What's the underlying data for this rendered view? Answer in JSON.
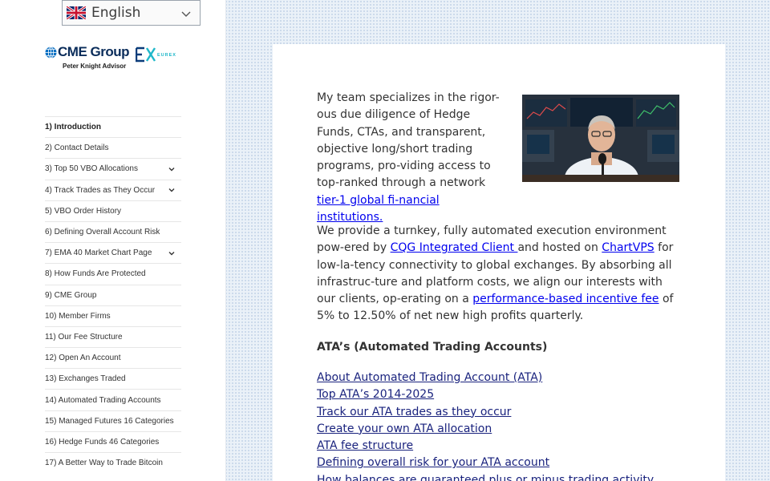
{
  "language": {
    "selected": "English"
  },
  "logo": {
    "brand": "CME Group",
    "subtitle": "Peter Knight Advisor",
    "partner": "EUREX"
  },
  "nav": {
    "items": [
      {
        "label": "1) Introduction",
        "has_toggle": false
      },
      {
        "label": "2) Contact Details",
        "has_toggle": false
      },
      {
        "label": "3) Top 50 VBO Allocations",
        "has_toggle": true
      },
      {
        "label": "4) Track Trades as They Occur",
        "has_toggle": true
      },
      {
        "label": "5) VBO Order History",
        "has_toggle": false
      },
      {
        "label": "6) Defining Overall Account Risk",
        "has_toggle": false
      },
      {
        "label": "7) EMA 40 Market Chart Page",
        "has_toggle": true
      },
      {
        "label": "8) How Funds Are Protected",
        "has_toggle": false
      },
      {
        "label": "9) CME Group",
        "has_toggle": false
      },
      {
        "label": "10) Member Firms",
        "has_toggle": false
      },
      {
        "label": "11) Our Fee Structure",
        "has_toggle": false
      },
      {
        "label": "12) Open An Account",
        "has_toggle": false
      },
      {
        "label": "13) Exchanges Traded",
        "has_toggle": false
      },
      {
        "label": "14) Automated Trading Accounts",
        "has_toggle": false
      },
      {
        "label": "15) Managed Futures 16 Categories",
        "has_toggle": false
      },
      {
        "label": "16) Hedge Funds 46 Categories",
        "has_toggle": false
      },
      {
        "label": "17) A Better Way to Trade Bitcoin",
        "has_toggle": false
      }
    ]
  },
  "content": {
    "para1_text": "My team specializes in the rigor-ous due diligence of Hedge Funds, CTAs, and transparent, objective long/short trading programs, pro-viding access to top-ranked through a network ",
    "para1_link": "tier-1 global fi-nancial institutions.",
    "para2_a": "We provide a turnkey, fully automated execution environment pow-ered by ",
    "para2_link1": "CQG Integrated Client ",
    "para2_b": "and hosted on ",
    "para2_link2": "ChartVPS",
    "para2_c": " for low-la-tency connectivity to global exchanges. By absorbing all infrastruc-ture and platform costs, we align our interests with our clients, op-erating on a ",
    "para2_link3": "performance-based incentive fee",
    "para2_d": " of 5% to 12.50% of net new high profits quarterly.",
    "heading": "ATA’s (Automated Trading Accounts)",
    "links": [
      "About Automated Trading Account (ATA) ",
      "Top ATA’s 2014-2025",
      "Track our ATA trades as they occur",
      "Create your own ATA allocation",
      "ATA fee structure",
      "Defining overall risk for your ATA account",
      "How balances are guaranteed plus or minus trading activity"
    ]
  }
}
